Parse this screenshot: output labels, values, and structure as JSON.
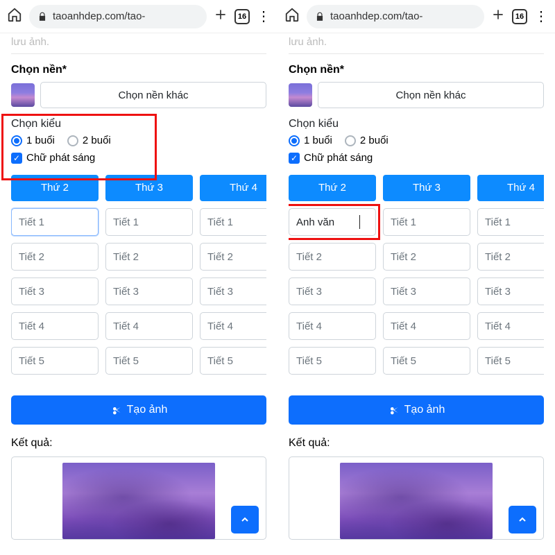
{
  "browser": {
    "url": "taoanhdep.com/tao-",
    "tab_count": "16"
  },
  "common": {
    "faded_text": "lưu ảnh.",
    "bg_label": "Chọn nền*",
    "bg_button": "Chọn nền khác",
    "style_label": "Chọn kiểu",
    "radio_one": "1 buổi",
    "radio_two": "2 buổi",
    "checkbox_glow": "Chữ phát sáng",
    "create_label": "Tạo ảnh",
    "result_label": "Kết quả:"
  },
  "schedule": {
    "days": [
      "Thứ 2",
      "Thứ 3",
      "Thứ 4"
    ],
    "periods": [
      "Tiết 1",
      "Tiết 2",
      "Tiết 3",
      "Tiết 4",
      "Tiết 5"
    ]
  },
  "right_entry": "Anh văn"
}
